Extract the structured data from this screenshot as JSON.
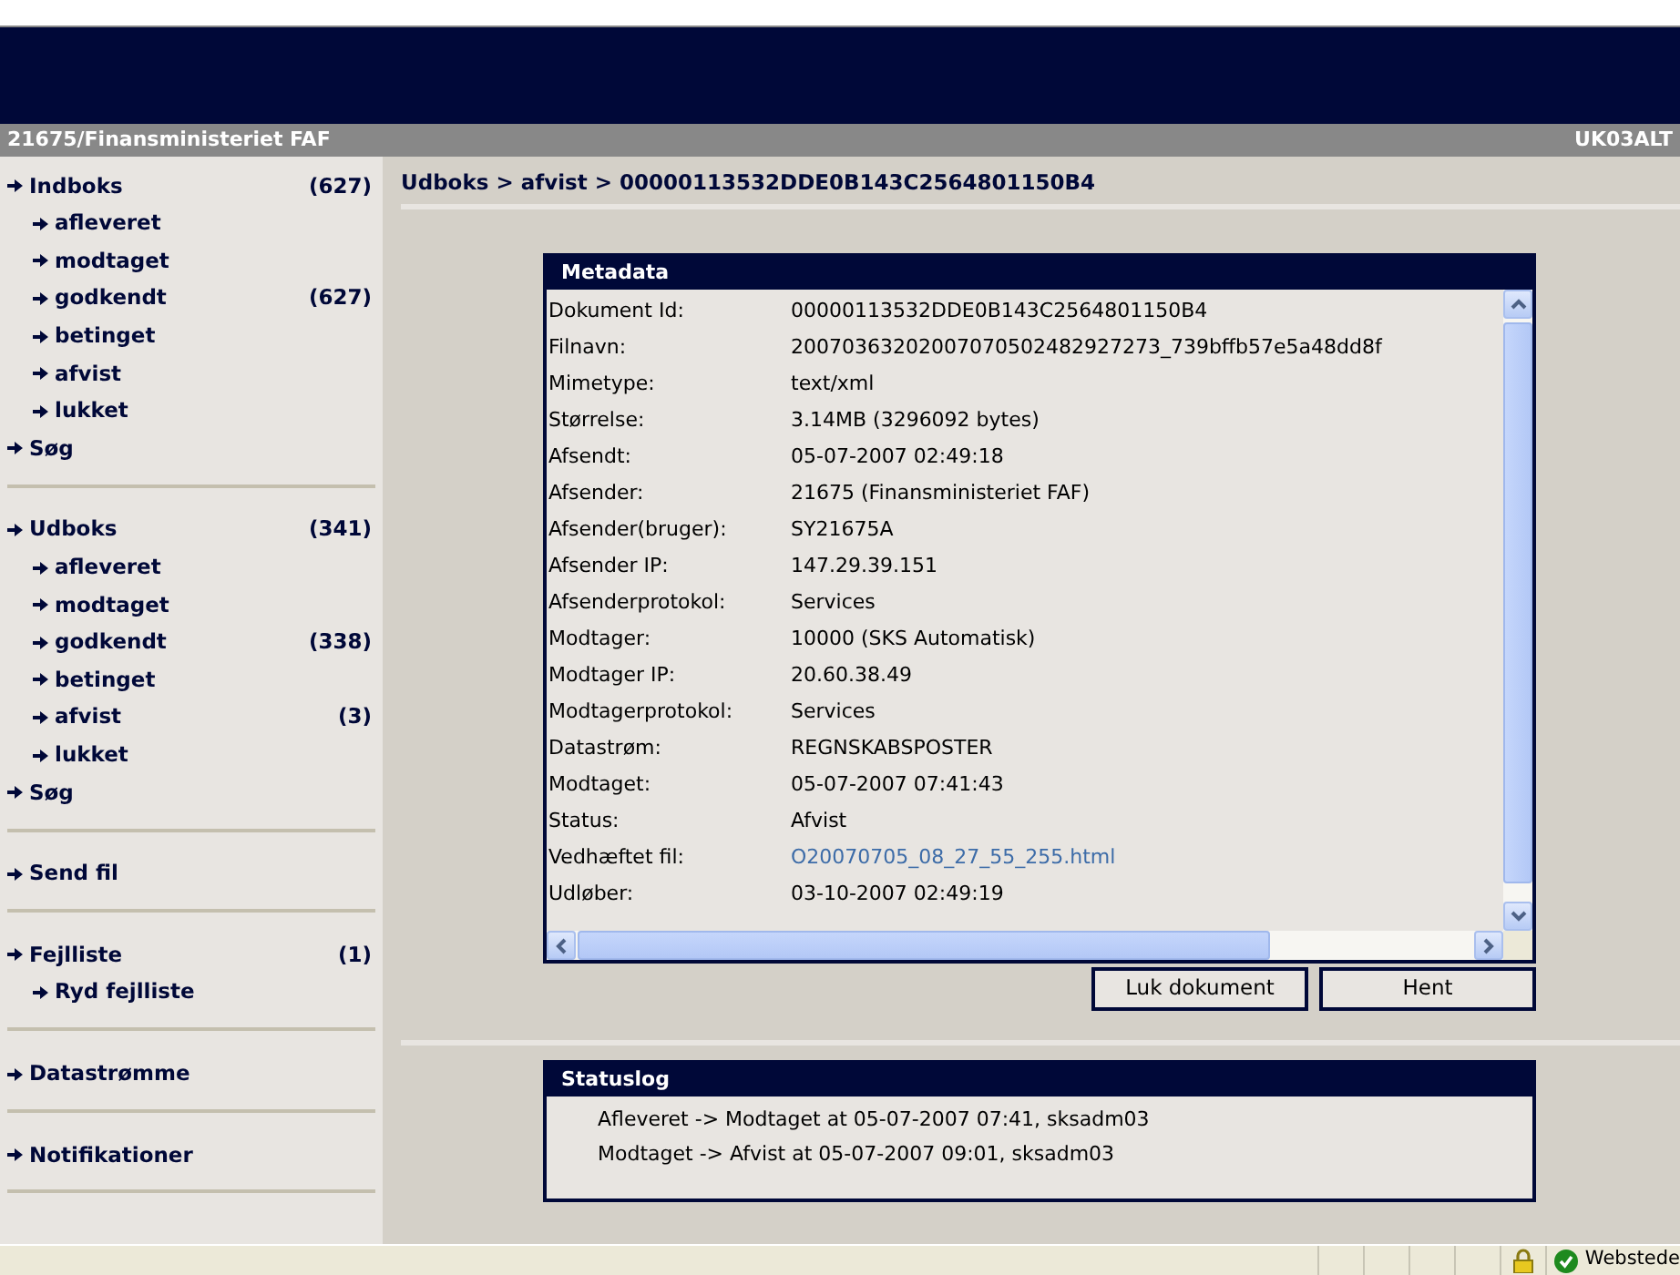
{
  "header": {
    "org": "21675/Finansministeriet FAF",
    "user": "UK03ALT"
  },
  "sidebar": {
    "groups": [
      {
        "items": [
          {
            "label": "Indboks",
            "count": "(627)",
            "children": [
              {
                "label": "afleveret"
              },
              {
                "label": "modtaget"
              },
              {
                "label": "godkendt",
                "count": "(627)"
              },
              {
                "label": "betinget"
              },
              {
                "label": "afvist"
              },
              {
                "label": "lukket"
              }
            ]
          },
          {
            "label": "Søg"
          }
        ]
      },
      {
        "items": [
          {
            "label": "Udboks",
            "count": "(341)",
            "children": [
              {
                "label": "afleveret"
              },
              {
                "label": "modtaget"
              },
              {
                "label": "godkendt",
                "count": "(338)"
              },
              {
                "label": "betinget"
              },
              {
                "label": "afvist",
                "count": "(3)"
              },
              {
                "label": "lukket"
              }
            ]
          },
          {
            "label": "Søg"
          }
        ]
      },
      {
        "items": [
          {
            "label": "Send fil"
          }
        ]
      },
      {
        "items": [
          {
            "label": "Fejlliste",
            "count": "(1)",
            "children": [
              {
                "label": "Ryd fejlliste"
              }
            ]
          }
        ]
      },
      {
        "items": [
          {
            "label": "Datastrømme"
          }
        ]
      },
      {
        "items": [
          {
            "label": "Notifikationer"
          }
        ]
      }
    ]
  },
  "breadcrumb": "Udboks > afvist > 00000113532DDE0B143C2564801150B4",
  "metadata": {
    "title": "Metadata",
    "rows": [
      {
        "label": "Dokument Id:",
        "value": "00000113532DDE0B143C2564801150B4"
      },
      {
        "label": "Filnavn:",
        "value": "20070363202007070502482927273_739bffb57e5a48dd8f"
      },
      {
        "label": "Mimetype:",
        "value": "text/xml"
      },
      {
        "label": "Størrelse:",
        "value": "3.14MB (3296092 bytes)"
      },
      {
        "label": "Afsendt:",
        "value": "05-07-2007 02:49:18"
      },
      {
        "label": "Afsender:",
        "value": "21675 (Finansministeriet FAF)"
      },
      {
        "label": "Afsender(bruger):",
        "value": "SY21675A"
      },
      {
        "label": "Afsender IP:",
        "value": "147.29.39.151"
      },
      {
        "label": "Afsenderprotokol:",
        "value": "Services"
      },
      {
        "label": "Modtager:",
        "value": "10000 (SKS Automatisk)"
      },
      {
        "label": "Modtager IP:",
        "value": "20.60.38.49"
      },
      {
        "label": "Modtagerprotokol:",
        "value": "Services"
      },
      {
        "label": "Datastrøm:",
        "value": "REGNSKABSPOSTER"
      },
      {
        "label": "Modtaget:",
        "value": "05-07-2007 07:41:43"
      },
      {
        "label": "Status:",
        "value": "Afvist"
      },
      {
        "label": "Vedhæftet fil:",
        "value": "O20070705_08_27_55_255.html",
        "kind": "link"
      },
      {
        "label": "Udløber:",
        "value": "03-10-2007 02:49:19"
      }
    ]
  },
  "buttons": [
    "Luk dokument",
    "Hent"
  ],
  "statuslog": {
    "title": "Statuslog",
    "entries": [
      "Afleveret -> Modtaget at 05-07-2007 07:41, sksadm03",
      "Modtaget -> Afvist at 05-07-2007 09:01, sksadm03"
    ]
  },
  "status_bar": {
    "zone": "Webstede"
  }
}
